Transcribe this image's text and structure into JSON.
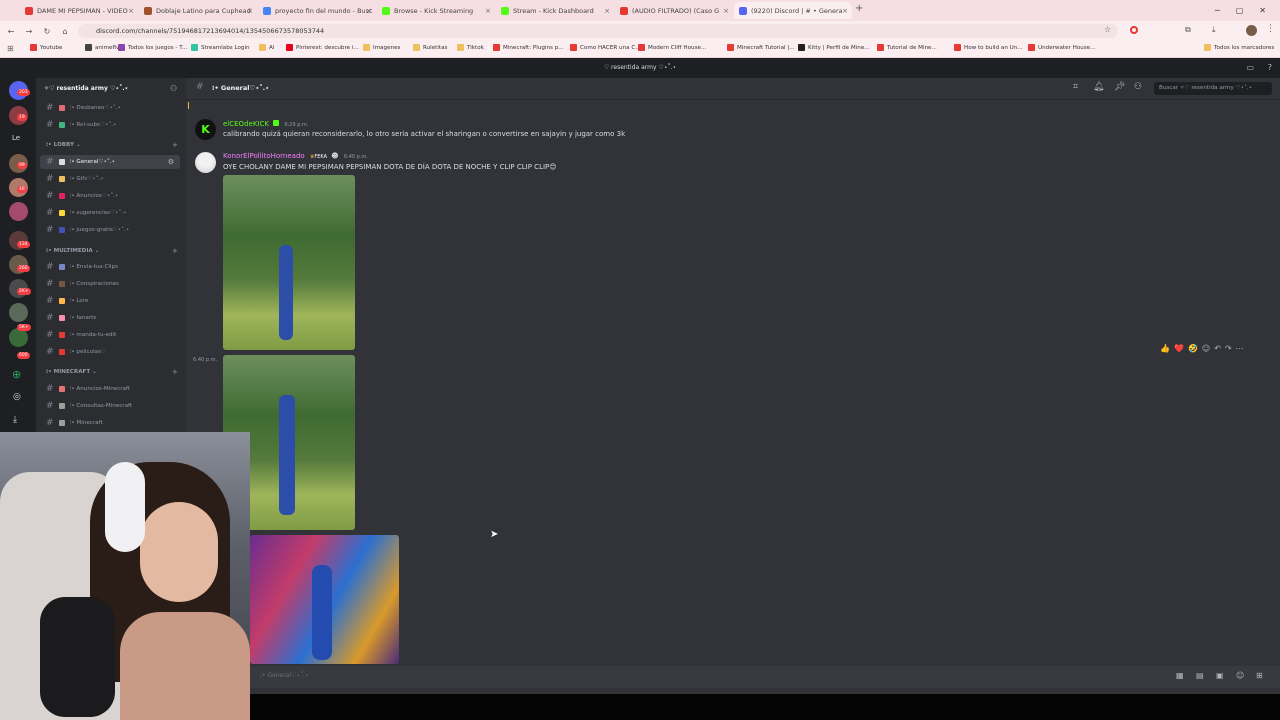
{
  "browser": {
    "tabs": [
      {
        "label": "DAME MI PEPSIMAN - VIDEO",
        "color": "#e53935",
        "active": false
      },
      {
        "label": "Doblaje Latino para Cuphead",
        "color": "#a0522d",
        "active": false
      },
      {
        "label": "proyecto fin del mundo - Busc",
        "color": "#4285f4",
        "active": false
      },
      {
        "label": "Browse - Kick Streaming",
        "color": "#53fc18",
        "active": false
      },
      {
        "label": "Stream - Kick Dashboard",
        "color": "#53fc18",
        "active": false
      },
      {
        "label": "(AUDIO FILTRADO) (Caso G",
        "color": "#e53935",
        "active": false
      },
      {
        "label": "(9220) Discord | # • Genera",
        "color": "#5865f2",
        "active": true
      }
    ],
    "url": "discord.com/channels/751946817213694014/1354506673578053744",
    "bookmarks": [
      {
        "label": "Youtube",
        "color": "#e53935"
      },
      {
        "label": "animeflv",
        "color": "#444"
      },
      {
        "label": "Todos los juegos - T...",
        "color": "#8e44ad"
      },
      {
        "label": "Streamlabs Login",
        "color": "#31c3a2"
      },
      {
        "label": "Al",
        "color": "#f0c060"
      },
      {
        "label": "Pinterest: descubre i...",
        "color": "#e60023"
      },
      {
        "label": "Imagenes",
        "color": "#f0c060"
      },
      {
        "label": "Ruletitas",
        "color": "#f0c060"
      },
      {
        "label": "Tiktok",
        "color": "#f0c060"
      },
      {
        "label": "Minecraft: Plugins p...",
        "color": "#e53935"
      },
      {
        "label": "Como HACER una C...",
        "color": "#e53935"
      },
      {
        "label": "Modern Cliff House...",
        "color": "#e53935"
      },
      {
        "label": "Minecraft Tutorial |...",
        "color": "#e53935"
      },
      {
        "label": "Kitty | Perfil de Mine...",
        "color": "#222"
      },
      {
        "label": "Tutorial de Mine...",
        "color": "#e53935"
      },
      {
        "label": "How to build an Un...",
        "color": "#e53935"
      },
      {
        "label": "Underwater House...",
        "color": "#e53935"
      }
    ],
    "all_bookmarks": "Todos los marcadores"
  },
  "discord": {
    "window_title": "♡ resentida army ♡⋆˚.⋆",
    "server_name": "✧♡ resentida army ♡⋆˚.⋆",
    "server_badges": [
      "203",
      "19",
      "99",
      "48",
      "134",
      "260",
      "2K+",
      "5K+",
      "600"
    ],
    "server_letters": "Le",
    "channels": [
      {
        "kind": "channel",
        "label": "⁝• Desbaneo♡⋆˚.⋆",
        "icon": "#e06c75"
      },
      {
        "kind": "channel",
        "label": "⁝• Rol-subs♡⋆˚.⋆",
        "icon": "#43b581"
      },
      {
        "kind": "category",
        "label": "⁝• LOBBY ⌄"
      },
      {
        "kind": "channel",
        "label": "⁝• General♡⋆˚.⋆",
        "icon": "#dbdee1",
        "active": true
      },
      {
        "kind": "channel",
        "label": "⁝• Gifs♡⋆˚.⋆",
        "icon": "#f0c060"
      },
      {
        "kind": "channel",
        "label": "⁝• Anuncios♡⋆˚.⋆",
        "icon": "#e91e63"
      },
      {
        "kind": "channel",
        "label": "⁝• sugerencias♡⋆˚.⋆",
        "icon": "#fdd835"
      },
      {
        "kind": "channel",
        "label": "⁝• juegos-gratis♡⋆˚.⋆",
        "icon": "#3f51b5"
      },
      {
        "kind": "category",
        "label": "⁝• MULTIMEDIA ⌄"
      },
      {
        "kind": "channel",
        "label": "⁝• Envia-tus-Clips",
        "icon": "#7986cb"
      },
      {
        "kind": "channel",
        "label": "⁝• Conspiraciones",
        "icon": "#795548"
      },
      {
        "kind": "channel",
        "label": "⁝• Lore",
        "icon": "#ffb74d"
      },
      {
        "kind": "channel",
        "label": "⁝• fanarts",
        "icon": "#f48fb1"
      },
      {
        "kind": "channel",
        "label": "⁝• manda-tu-edit",
        "icon": "#e53935"
      },
      {
        "kind": "channel",
        "label": "⁝• peliculas♡",
        "icon": "#e53935"
      },
      {
        "kind": "category",
        "label": "⁝• MINECRAFT ⌄"
      },
      {
        "kind": "channel",
        "label": "⁝• Anuncios-Minecraft",
        "icon": "#e57373"
      },
      {
        "kind": "channel",
        "label": "⁝• Consultas-Minecraft",
        "icon": "#9e9e9e"
      },
      {
        "kind": "channel",
        "label": "⁝• Minecraft",
        "icon": "#9e9e9e"
      }
    ],
    "channel_header": "⁝• General♡⋆˚.⋆",
    "search_placeholder": "Buscar ✧♡ resentida army ♡⋆˚.⋆",
    "messages": [
      {
        "author": "elCEOdeKICK",
        "author_color": "#53fc18",
        "time": "6:29 p.m.",
        "text": "calibrando quizá quieran reconsiderarlo, lo otro sería activar el sharingan o convertirse en sajayin y jugar como 3k"
      },
      {
        "author": "KonorElPollitoHorneado",
        "author_color": "#f47fff",
        "tag": "FEKA",
        "time": "6:40 p.m.",
        "text": "OYE CHOLANY DAME MI PEPSIMAN PEPSIMAN DOTA DE DÍA DOTA DE NOCHE Y CLIP CLIP CLIP😊"
      }
    ],
    "followup_time": "6:40 p.m.",
    "reactions": [
      "👍",
      "❤️",
      "🤣"
    ],
    "composer_placeholder": "⁝• General♡⋆˚.⋆"
  }
}
